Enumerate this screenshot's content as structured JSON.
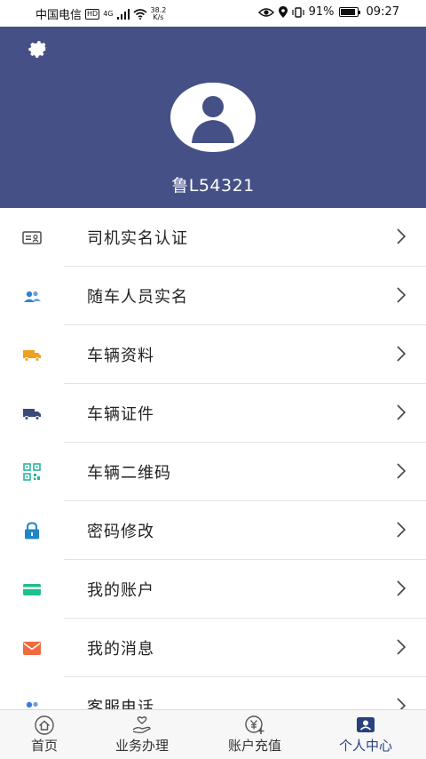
{
  "status_bar": {
    "carrier": "中国电信",
    "hd": "HD",
    "network": "4G",
    "net_speed_value": "38.2",
    "net_speed_unit": "K/s",
    "battery_percent": "91%",
    "battery_level": 0.91,
    "time": "09:27"
  },
  "profile": {
    "plate_number": "鲁L54321",
    "settings_icon": "gear-icon",
    "avatar_icon": "user-avatar-icon"
  },
  "menu": {
    "items": [
      {
        "label": "司机实名认证",
        "icon": "id-card-icon",
        "color": "#4a4a4a"
      },
      {
        "label": "随车人员实名",
        "icon": "people-icon",
        "color": "#3b7fd0"
      },
      {
        "label": "车辆资料",
        "icon": "truck-icon",
        "color": "#f0a020"
      },
      {
        "label": "车辆证件",
        "icon": "truck-icon",
        "color": "#3c4a7a"
      },
      {
        "label": "车辆二维码",
        "icon": "qr-code-icon",
        "color": "#2bb39a"
      },
      {
        "label": "密码修改",
        "icon": "lock-icon",
        "color": "#1f86c8"
      },
      {
        "label": "我的账户",
        "icon": "card-icon",
        "color": "#1fbf8f"
      },
      {
        "label": "我的消息",
        "icon": "mail-icon",
        "color": "#f06a40"
      },
      {
        "label": "客服电话",
        "icon": "people-icon",
        "color": "#3b7fd0"
      }
    ]
  },
  "bottom_nav": {
    "tabs": [
      {
        "label": "首页",
        "icon": "home-icon"
      },
      {
        "label": "业务办理",
        "icon": "service-hand-icon"
      },
      {
        "label": "账户充值",
        "icon": "yuan-add-icon"
      },
      {
        "label": "个人中心",
        "icon": "profile-card-icon"
      }
    ],
    "active_index": 3
  },
  "colors": {
    "header_bg": "#455186",
    "accent": "#2a3f7e"
  }
}
